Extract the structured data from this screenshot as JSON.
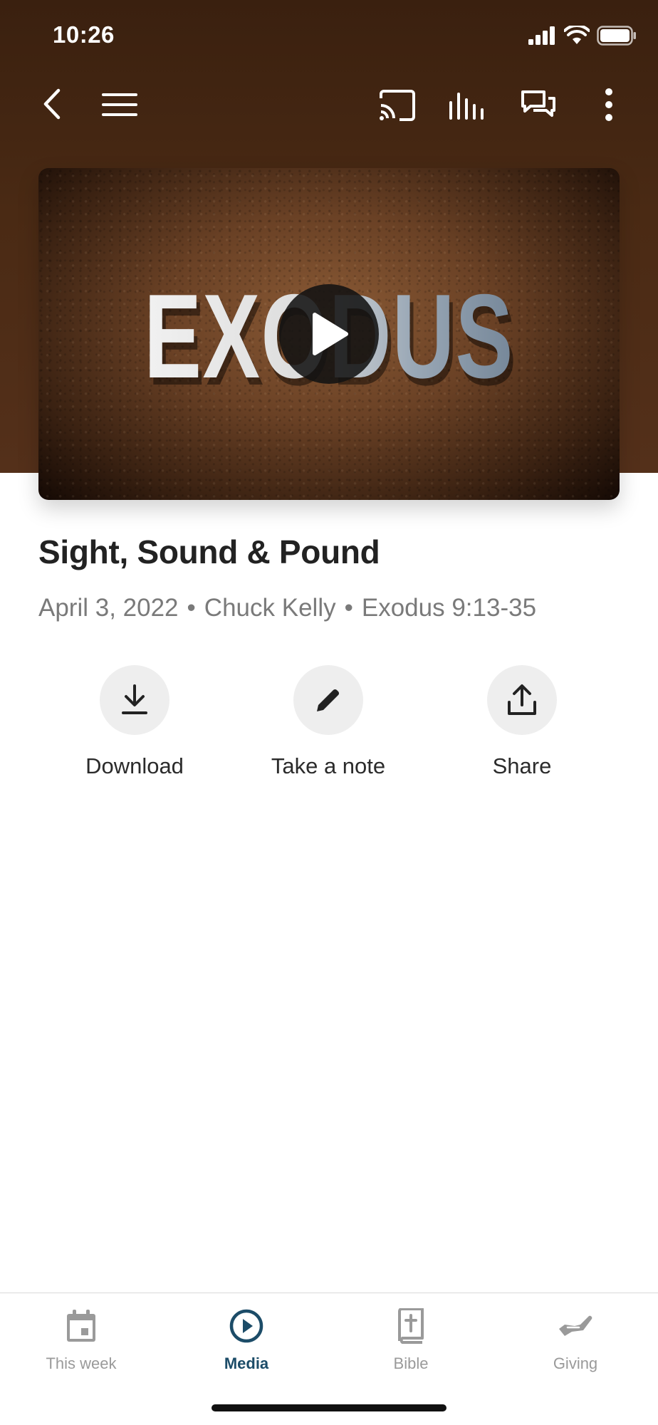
{
  "status_bar": {
    "time": "10:26"
  },
  "toolbar": {
    "icons": [
      "back-icon",
      "menu-icon",
      "cast-icon",
      "audio-icon",
      "chat-icon",
      "more-icon"
    ]
  },
  "video": {
    "thumbnail_text": "EXODUS"
  },
  "sermon": {
    "title": "Sight, Sound & Pound",
    "date": "April 3, 2022",
    "speaker": "Chuck Kelly",
    "scripture": "Exodus 9:13-35",
    "separator": "•"
  },
  "actions": [
    {
      "label": "Download",
      "icon": "download-icon"
    },
    {
      "label": "Take a note",
      "icon": "pencil-icon"
    },
    {
      "label": "Share",
      "icon": "share-icon"
    }
  ],
  "tabs": [
    {
      "label": "This week",
      "icon": "calendar-icon",
      "active": false
    },
    {
      "label": "Media",
      "icon": "play-circle-icon",
      "active": true
    },
    {
      "label": "Bible",
      "icon": "bible-icon",
      "active": false
    },
    {
      "label": "Giving",
      "icon": "giving-hand-icon",
      "active": false
    }
  ],
  "colors": {
    "header_brown": "#4a2a14",
    "active_tab": "#1c4c68",
    "inactive_tab": "#9a9a9a"
  }
}
